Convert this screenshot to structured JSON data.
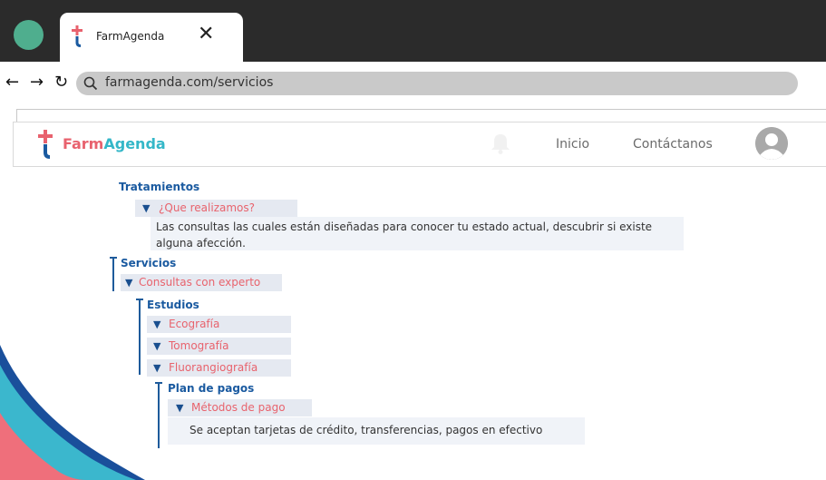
{
  "browser": {
    "tab_title": "FarmAgenda",
    "tab_close": "✕",
    "new_tab": "+",
    "back": "←",
    "forward": "→",
    "reload": "↻",
    "url": "farmagenda.com/servicios"
  },
  "site": {
    "brand_farm": "Farm",
    "brand_agenda": "Agenda",
    "nav": {
      "inicio": "Inicio",
      "contactanos": "Contáctanos"
    }
  },
  "content": {
    "tratamientos": {
      "heading": "Tratamientos",
      "question": "¿Que realizamos?",
      "description": "Las consultas las cuales están diseñadas para conocer tu estado actual, descubrir si existe alguna afección."
    },
    "servicios": {
      "heading": "Servicios",
      "item": "Consultas con experto"
    },
    "estudios": {
      "heading": "Estudios",
      "items": [
        "Ecografía",
        "Tomografía",
        "Fluorangiografía"
      ]
    },
    "plan_pagos": {
      "heading": "Plan de pagos",
      "item": "Métodos de pago",
      "description": "Se aceptan tarjetas de crédito, transferencias, pagos en efectivo"
    }
  },
  "colors": {
    "brand_red": "#e8626e",
    "brand_teal": "#34b7c8",
    "heading_blue": "#1a5aa0",
    "accordion_bg": "#e5e9f1"
  }
}
